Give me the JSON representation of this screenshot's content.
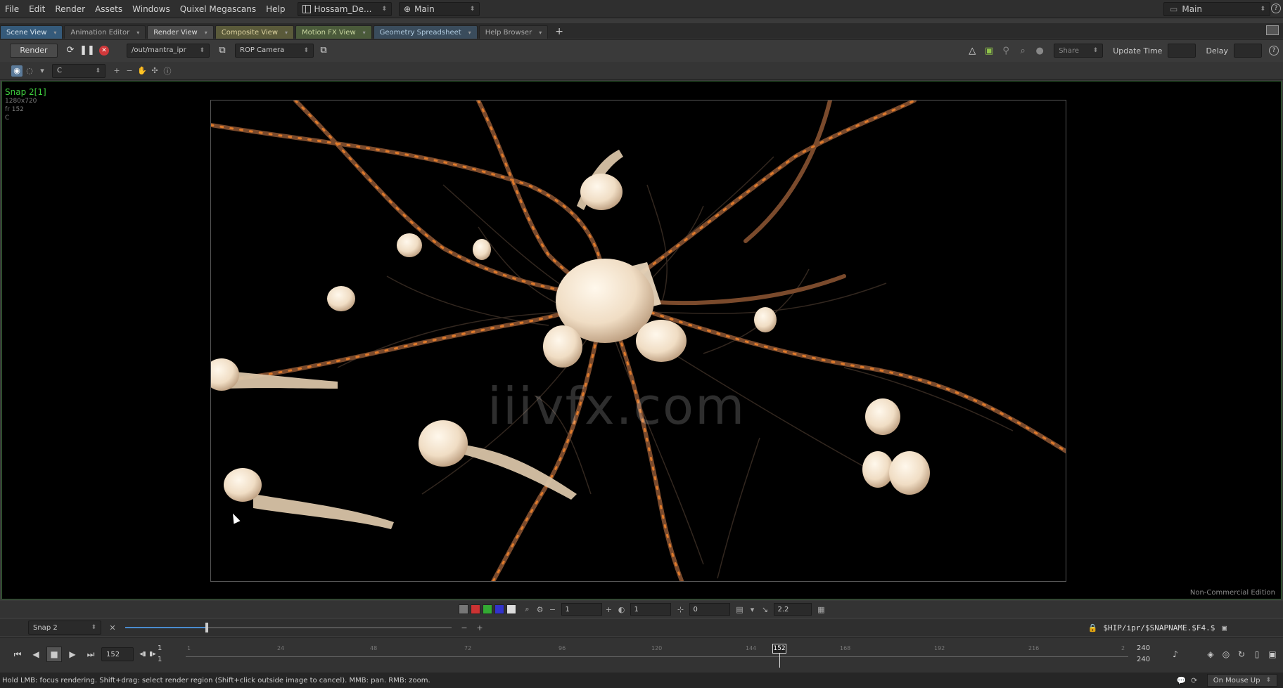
{
  "menubar": {
    "items": [
      "File",
      "Edit",
      "Render",
      "Assets",
      "Windows",
      "Quixel Megascans",
      "Help"
    ],
    "desk": "Hossam_De...",
    "context": "Main",
    "main_right": "Main"
  },
  "tabs": [
    {
      "label": "Scene View",
      "style": "scene"
    },
    {
      "label": "Animation Editor",
      "style": "normal"
    },
    {
      "label": "Render View",
      "style": "active"
    },
    {
      "label": "Composite View",
      "style": "composite"
    },
    {
      "label": "Motion FX View",
      "style": "motionfx"
    },
    {
      "label": "Geometry Spreadsheet",
      "style": "geosheet"
    },
    {
      "label": "Help Browser",
      "style": "normal"
    }
  ],
  "render_toolbar": {
    "render_label": "Render",
    "rop_path": "/out/mantra_ipr",
    "camera": "ROP Camera",
    "share_label": "Share",
    "update_time_label": "Update Time",
    "delay_label": "Delay"
  },
  "viewer_toolbar": {
    "channel": "C"
  },
  "viewport": {
    "snap_name": "Snap 2[1]",
    "resolution": "1280x720",
    "frame": "fr 152",
    "channel": "C",
    "watermark": "iiivfx.com",
    "edition": "Non-Commercial Edition"
  },
  "display_bar": {
    "zoom_value": "1",
    "brightness_value": "1",
    "offset_value": "0",
    "gamma_value": "2.2"
  },
  "snap_bar": {
    "snap_select": "Snap 2",
    "output_path": "$HIP/ipr/$SNAPNAME.$F4.$"
  },
  "playbar": {
    "current_frame": "152",
    "start_frame_1": "1",
    "start_frame_2": "1",
    "end_frame_1": "240",
    "end_frame_2": "240",
    "cursor_frame": "152",
    "ticks": [
      "1",
      "24",
      "48",
      "72",
      "96",
      "120",
      "144",
      "168",
      "192",
      "216",
      "2"
    ]
  },
  "statusbar": {
    "message": "Hold LMB: focus rendering. Shift+drag: select render region (Shift+click outside image to cancel). MMB: pan. RMB: zoom.",
    "update_mode": "On Mouse Up"
  },
  "colors": {
    "accent": "#4a8ccf",
    "snap_name": "#3fcf3f",
    "stop": "#d0383a",
    "soma": "#f3e6d3",
    "dendrite": "#6b4a35",
    "glow": "#e07a2a"
  }
}
